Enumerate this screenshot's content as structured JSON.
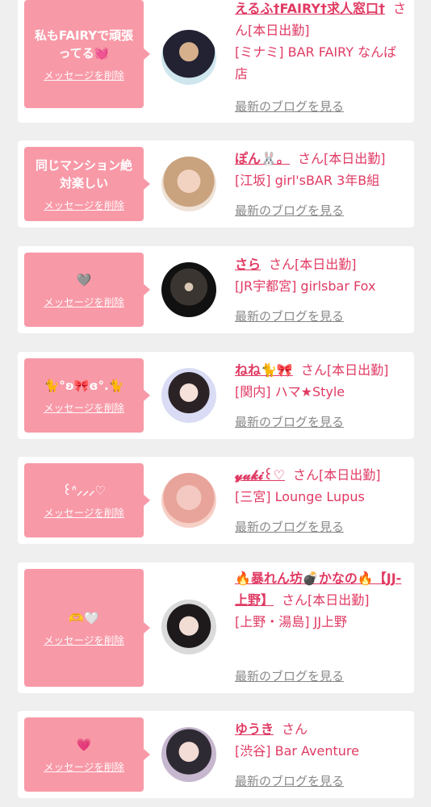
{
  "delete_label": "メッセージを削除",
  "blog_label": "最新のブログを見る",
  "honorific": "さん",
  "cards": [
    {
      "message": "私もFAIRYで頑張ってる💓",
      "name": "えるふ†FAIRY†求人窓口†",
      "status": "[本日出勤]",
      "area": "[ミナミ]",
      "shop": "BAR FAIRY なんば店"
    },
    {
      "message": "同じマンション絶対楽しい",
      "name": "ぽん🐰。",
      "status": "[本日出勤]",
      "area": "[江坂]",
      "shop": "girl'sBAR 3年B組"
    },
    {
      "message": "🩶",
      "name": "さら",
      "status": "[本日出勤]",
      "area": "[JR宇都宮]",
      "shop": "girlsbar Fox"
    },
    {
      "message": "🐈°ʚ🎀ɞ°.🐈",
      "name": "ねね🐈🎀",
      "status": "[本日出勤]",
      "area": "[関内]",
      "shop": "ハマ★Style"
    },
    {
      "message": "꒰ᐢ⸝⸝⸝♡",
      "name": "𝔂𝓾𝓴𝓲꒰♡",
      "status": "[本日出勤]",
      "area": "[三宮]",
      "shop": "Lounge Lupus"
    },
    {
      "message": "🫶🤍",
      "name": "🔥暴れん坊💣かなの🔥【JJ-上野】",
      "status": "[本日出勤]",
      "area": "[上野・湯島]",
      "shop": "JJ上野"
    },
    {
      "message": "💗",
      "name": "ゆうき",
      "status": "",
      "area": "[渋谷]",
      "shop": "Bar Aventure"
    }
  ],
  "colors": {
    "bubble": "#f899a7",
    "accent": "#e03a63",
    "background": "#efefef"
  }
}
